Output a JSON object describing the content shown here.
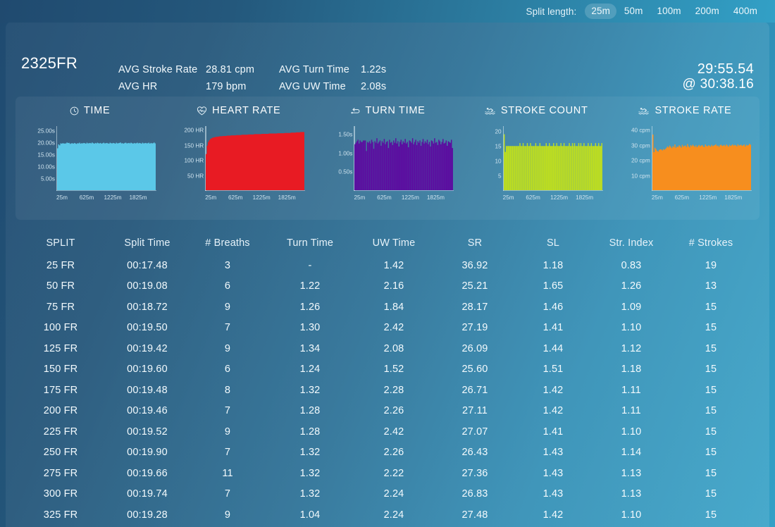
{
  "topbar": {
    "label": "Split length:",
    "options": [
      "25m",
      "50m",
      "100m",
      "200m",
      "400m"
    ],
    "active": "25m"
  },
  "header": {
    "title": "2325FR",
    "stats": [
      {
        "key": "AVG Stroke Rate",
        "value": "28.81 cpm"
      },
      {
        "key": "AVG Turn Time",
        "value": "1.22s"
      },
      {
        "key": "AVG HR",
        "value": "179 bpm"
      },
      {
        "key": "AVG UW Time",
        "value": "2.08s"
      }
    ],
    "total_time": "29:55.54",
    "target_time": "@ 30:38.16"
  },
  "charts": [
    {
      "title": "TIME",
      "icon": "clock-icon",
      "color": "#5bc8e8",
      "ylabels": [
        "25.00s",
        "20.00s",
        "15.00s",
        "10.00s",
        "5.00s"
      ],
      "xlabels": [
        "25m",
        "625m",
        "1225m",
        "1825m"
      ]
    },
    {
      "title": "HEART RATE",
      "icon": "heart-rate-icon",
      "color": "#e81b23",
      "ylabels": [
        "200 HR",
        "150 HR",
        "100 HR",
        "50 HR"
      ],
      "xlabels": [
        "25m",
        "625m",
        "1225m",
        "1825m"
      ]
    },
    {
      "title": "TURN TIME",
      "icon": "turn-icon",
      "color": "#5c0ca0",
      "ylabels": [
        "1.50s",
        "1.00s",
        "0.50s"
      ],
      "xlabels": [
        "25m",
        "625m",
        "1225m",
        "1825m"
      ]
    },
    {
      "title": "STROKE COUNT",
      "icon": "swimmer-icon",
      "color": "#bede1f",
      "ylabels": [
        "20",
        "15",
        "10",
        "5"
      ],
      "xlabels": [
        "25m",
        "625m",
        "1225m",
        "1825m"
      ]
    },
    {
      "title": "STROKE RATE",
      "icon": "swimmer-icon",
      "color": "#f78e1e",
      "ylabels": [
        "40 cpm",
        "30 cpm",
        "20 cpm",
        "10 cpm"
      ],
      "xlabels": [
        "25m",
        "625m",
        "1225m",
        "1825m"
      ]
    }
  ],
  "chart_data": [
    {
      "type": "area",
      "title": "TIME",
      "ylabel": "",
      "xlabel": "",
      "ylim": [
        0,
        27
      ],
      "yticks": [
        5,
        10,
        15,
        20,
        25
      ],
      "ytick_labels": [
        "5.00s",
        "10.00s",
        "15.00s",
        "20.00s",
        "25.00s"
      ],
      "xticks": [
        25,
        625,
        1225,
        1825
      ],
      "xtick_labels": [
        "25m",
        "625m",
        "1225m",
        "1825m"
      ],
      "color": "#5bc8e8",
      "values": [
        17.48,
        19.08,
        18.72,
        19.5,
        19.42,
        19.6,
        19.48,
        19.46,
        19.52,
        19.9,
        19.66,
        19.74,
        19.28,
        19.5,
        19.6,
        19.4,
        19.7,
        19.5,
        19.3,
        19.6,
        19.5,
        19.8,
        19.4,
        19.6,
        19.5,
        19.7,
        19.6,
        19.4,
        19.8,
        19.5,
        19.6,
        19.7,
        19.5,
        19.9,
        19.6,
        19.4,
        19.7,
        19.5,
        19.8,
        19.6,
        19.5,
        19.7,
        19.4,
        19.6,
        19.8,
        19.5,
        19.6,
        19.7,
        19.5,
        19.4,
        19.8,
        19.6,
        19.5,
        19.7,
        19.6,
        19.4,
        19.8,
        19.5,
        19.6,
        19.7,
        19.9,
        19.5,
        19.6,
        19.4,
        19.7,
        19.8,
        19.5,
        19.6,
        19.7,
        19.5,
        19.8,
        19.6,
        19.4,
        19.7,
        19.5,
        19.6,
        19.8,
        19.5,
        19.7,
        19.6,
        19.4,
        19.8,
        19.5,
        19.6,
        19.7,
        19.5,
        19.6,
        19.8,
        19.4,
        19.7,
        19.5,
        19.6,
        19.9,
        19.5
      ]
    },
    {
      "type": "area",
      "title": "HEART RATE",
      "ylabel": "",
      "xlabel": "",
      "ylim": [
        0,
        215
      ],
      "yticks": [
        50,
        100,
        150,
        200
      ],
      "ytick_labels": [
        "50 HR",
        "100 HR",
        "150 HR",
        "200 HR"
      ],
      "xticks": [
        25,
        625,
        1225,
        1825
      ],
      "xtick_labels": [
        "25m",
        "625m",
        "1225m",
        "1825m"
      ],
      "color": "#e81b23",
      "values": [
        120,
        148,
        160,
        166,
        170,
        172,
        174,
        175,
        176,
        177,
        177,
        178,
        178,
        179,
        179,
        179,
        180,
        180,
        180,
        180,
        181,
        181,
        181,
        181,
        182,
        182,
        182,
        182,
        182,
        183,
        183,
        183,
        183,
        183,
        184,
        184,
        184,
        184,
        184,
        184,
        185,
        185,
        185,
        185,
        185,
        185,
        186,
        186,
        186,
        186,
        186,
        186,
        186,
        187,
        187,
        187,
        187,
        187,
        187,
        187,
        188,
        188,
        188,
        188,
        188,
        188,
        188,
        188,
        189,
        189,
        189,
        189,
        189,
        189,
        189,
        190,
        190,
        190,
        190,
        190,
        190,
        191,
        191,
        191,
        191,
        191,
        192,
        192,
        192,
        192,
        193,
        193,
        193,
        193
      ]
    },
    {
      "type": "bar",
      "title": "TURN TIME",
      "ylabel": "",
      "xlabel": "",
      "ylim": [
        0,
        1.72
      ],
      "yticks": [
        0.5,
        1.0,
        1.5
      ],
      "ytick_labels": [
        "0.50s",
        "1.00s",
        "1.50s"
      ],
      "xticks": [
        25,
        625,
        1225,
        1825
      ],
      "xtick_labels": [
        "25m",
        "625m",
        "1225m",
        "1825m"
      ],
      "color": "#5c0ca0",
      "values": [
        1.22,
        1.26,
        1.3,
        1.34,
        1.24,
        1.32,
        1.28,
        1.28,
        1.32,
        1.32,
        1.32,
        1.04,
        1.28,
        1.26,
        1.3,
        1.24,
        1.34,
        1.28,
        1.1,
        1.3,
        1.26,
        1.38,
        1.24,
        1.28,
        1.32,
        1.18,
        1.3,
        1.26,
        1.36,
        1.22,
        1.28,
        1.3,
        1.12,
        1.34,
        1.26,
        1.28,
        1.2,
        1.32,
        1.26,
        1.38,
        1.24,
        1.3,
        1.16,
        1.28,
        1.34,
        1.22,
        1.3,
        1.26,
        1.36,
        1.24,
        1.28,
        1.14,
        1.32,
        1.3,
        1.26,
        1.38,
        1.22,
        1.28,
        1.34,
        1.2,
        1.3,
        1.26,
        1.32,
        1.18,
        1.28,
        1.36,
        1.24,
        1.3,
        1.26,
        1.34,
        1.22,
        1.28,
        1.16,
        1.32,
        1.3,
        1.24,
        1.38,
        1.26,
        1.28,
        1.2,
        1.34,
        1.3,
        1.22,
        1.28,
        1.36,
        1.24,
        1.26,
        1.32,
        1.18,
        1.3,
        1.28,
        1.26,
        1.34,
        1.12
      ]
    },
    {
      "type": "bar",
      "title": "STROKE COUNT",
      "ylabel": "",
      "xlabel": "",
      "ylim": [
        0,
        22
      ],
      "yticks": [
        5,
        10,
        15,
        20
      ],
      "ytick_labels": [
        "5",
        "10",
        "15",
        "20"
      ],
      "xticks": [
        25,
        625,
        1225,
        1825
      ],
      "xtick_labels": [
        "25m",
        "625m",
        "1225m",
        "1825m"
      ],
      "color": "#bede1f",
      "values": [
        19,
        13,
        15,
        15,
        15,
        15,
        15,
        15,
        15,
        15,
        15,
        15,
        15,
        15,
        15,
        16,
        15,
        15,
        16,
        15,
        15,
        15,
        16,
        15,
        15,
        16,
        15,
        15,
        15,
        15,
        16,
        15,
        15,
        15,
        16,
        15,
        15,
        15,
        15,
        15,
        16,
        15,
        15,
        16,
        15,
        15,
        15,
        16,
        15,
        15,
        16,
        15,
        15,
        15,
        16,
        15,
        15,
        16,
        15,
        15,
        15,
        15,
        16,
        15,
        15,
        16,
        15,
        16,
        15,
        15,
        15,
        16,
        15,
        16,
        15,
        15,
        16,
        15,
        15,
        15,
        16,
        15,
        15,
        16,
        15,
        15,
        15,
        16,
        15,
        15,
        16,
        15,
        15,
        16
      ]
    },
    {
      "type": "area",
      "title": "STROKE RATE",
      "ylabel": "",
      "xlabel": "",
      "ylim": [
        0,
        43
      ],
      "yticks": [
        10,
        20,
        30,
        40
      ],
      "ytick_labels": [
        "10 cpm",
        "20 cpm",
        "30 cpm",
        "40 cpm"
      ],
      "xticks": [
        25,
        625,
        1225,
        1825
      ],
      "xtick_labels": [
        "25m",
        "625m",
        "1225m",
        "1825m"
      ],
      "color": "#f78e1e",
      "values": [
        36.92,
        25.21,
        28.17,
        27.19,
        26.09,
        25.6,
        26.71,
        27.11,
        27.07,
        26.43,
        27.36,
        26.83,
        27.48,
        28.2,
        29.1,
        28.4,
        29.6,
        28.8,
        27.9,
        29.2,
        28.6,
        30.4,
        28.1,
        29.0,
        28.7,
        29.8,
        29.2,
        28.3,
        30.1,
        28.9,
        29.4,
        29.7,
        28.6,
        30.6,
        29.1,
        28.4,
        29.9,
        29.2,
        30.2,
        29.5,
        28.8,
        29.8,
        28.5,
        29.3,
        30.0,
        29.1,
        29.6,
        29.9,
        29.0,
        28.7,
        30.3,
        29.4,
        29.1,
        29.8,
        29.5,
        28.9,
        30.1,
        29.2,
        29.6,
        29.9,
        30.5,
        29.3,
        29.7,
        28.8,
        29.9,
        30.2,
        29.4,
        29.6,
        30.0,
        29.2,
        30.3,
        29.7,
        28.9,
        30.1,
        29.4,
        29.8,
        30.4,
        29.5,
        30.0,
        29.8,
        29.1,
        30.5,
        29.6,
        29.9,
        30.2,
        29.4,
        29.8,
        30.3,
        29.0,
        30.1,
        29.6,
        29.9,
        30.8,
        30.2
      ]
    }
  ],
  "table": {
    "columns": [
      "SPLIT",
      "Split Time",
      "# Breaths",
      "Turn Time",
      "UW Time",
      "SR",
      "SL",
      "Str. Index",
      "# Strokes"
    ],
    "rows": [
      [
        "25 FR",
        "00:17.48",
        "3",
        "-",
        "1.42",
        "36.92",
        "1.18",
        "0.83",
        "19"
      ],
      [
        "50 FR",
        "00:19.08",
        "6",
        "1.22",
        "2.16",
        "25.21",
        "1.65",
        "1.26",
        "13"
      ],
      [
        "75 FR",
        "00:18.72",
        "9",
        "1.26",
        "1.84",
        "28.17",
        "1.46",
        "1.09",
        "15"
      ],
      [
        "100 FR",
        "00:19.50",
        "7",
        "1.30",
        "2.42",
        "27.19",
        "1.41",
        "1.10",
        "15"
      ],
      [
        "125 FR",
        "00:19.42",
        "9",
        "1.34",
        "2.08",
        "26.09",
        "1.44",
        "1.12",
        "15"
      ],
      [
        "150 FR",
        "00:19.60",
        "6",
        "1.24",
        "1.52",
        "25.60",
        "1.51",
        "1.18",
        "15"
      ],
      [
        "175 FR",
        "00:19.48",
        "8",
        "1.32",
        "2.28",
        "26.71",
        "1.42",
        "1.11",
        "15"
      ],
      [
        "200 FR",
        "00:19.46",
        "7",
        "1.28",
        "2.26",
        "27.11",
        "1.42",
        "1.11",
        "15"
      ],
      [
        "225 FR",
        "00:19.52",
        "9",
        "1.28",
        "2.42",
        "27.07",
        "1.41",
        "1.10",
        "15"
      ],
      [
        "250 FR",
        "00:19.90",
        "7",
        "1.32",
        "2.26",
        "26.43",
        "1.43",
        "1.14",
        "15"
      ],
      [
        "275 FR",
        "00:19.66",
        "11",
        "1.32",
        "2.22",
        "27.36",
        "1.43",
        "1.13",
        "15"
      ],
      [
        "300 FR",
        "00:19.74",
        "7",
        "1.32",
        "2.24",
        "26.83",
        "1.43",
        "1.13",
        "15"
      ],
      [
        "325 FR",
        "00:19.28",
        "9",
        "1.04",
        "2.24",
        "27.48",
        "1.42",
        "1.10",
        "15"
      ]
    ]
  }
}
